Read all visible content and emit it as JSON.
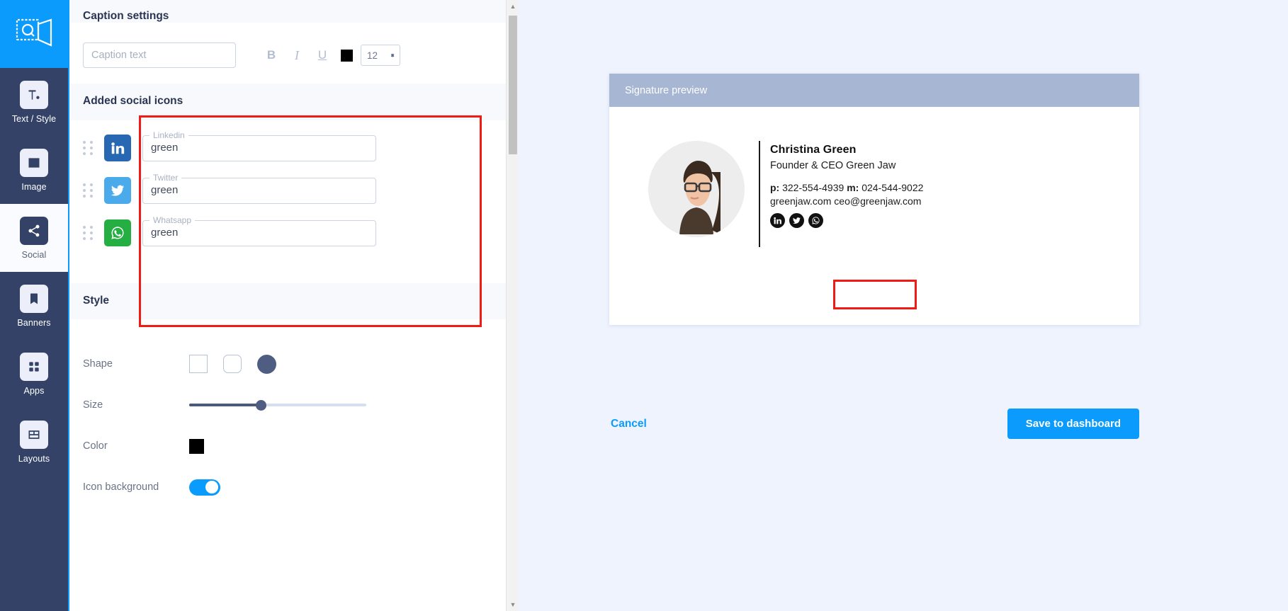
{
  "rail": {
    "logo_icon": "envelope-stamp-logo-icon",
    "items": [
      {
        "label": "Text / Style",
        "icon": "text-style-icon",
        "active": false
      },
      {
        "label": "Image",
        "icon": "image-icon",
        "active": false
      },
      {
        "label": "Social",
        "icon": "share-icon",
        "active": true
      },
      {
        "label": "Banners",
        "icon": "bookmark-icon",
        "active": false
      },
      {
        "label": "Apps",
        "icon": "grid-apps-icon",
        "active": false
      },
      {
        "label": "Layouts",
        "icon": "layouts-icon",
        "active": false
      }
    ]
  },
  "caption": {
    "heading": "Caption settings",
    "input_value": "",
    "input_placeholder": "Caption text",
    "bold_label": "B",
    "italic_label": "I",
    "underline_label": "U",
    "text_color": "#000000",
    "font_size": "12"
  },
  "social": {
    "heading": "Added social icons",
    "rows": [
      {
        "network": "Linkedin",
        "value": "green",
        "brand_color": "#2867b2",
        "icon": "linkedin-icon"
      },
      {
        "network": "Twitter",
        "value": "green",
        "brand_color": "#4aaaea",
        "icon": "twitter-icon"
      },
      {
        "network": "Whatsapp",
        "value": "green",
        "brand_color": "#25ae41",
        "icon": "whatsapp-icon"
      }
    ]
  },
  "style": {
    "heading": "Style",
    "shape_label": "Shape",
    "shape_options": [
      "square",
      "rounded-square",
      "circle"
    ],
    "shape_selected": "circle",
    "size_label": "Size",
    "size_percent": 40,
    "color_label": "Color",
    "color_value": "#000000",
    "icon_background_label": "Icon background",
    "icon_background_on": true
  },
  "preview": {
    "header_title": "Signature preview",
    "signature": {
      "name": "Christina Green",
      "role": "Founder & CEO Green Jaw",
      "phone_label": "p:",
      "phone": "322-554-4939",
      "mobile_label": "m:",
      "mobile": "024-544-9022",
      "website": "greenjaw.com",
      "email": "ceo@greenjaw.com",
      "socials": [
        {
          "network": "Linkedin",
          "icon": "linkedin-icon"
        },
        {
          "network": "Twitter",
          "icon": "twitter-icon"
        },
        {
          "network": "Whatsapp",
          "icon": "whatsapp-icon"
        }
      ]
    }
  },
  "actions": {
    "cancel_label": "Cancel",
    "save_label": "Save to dashboard"
  },
  "colors": {
    "accent": "#0a9bfc",
    "rail_bg": "#334266",
    "highlight": "#ef1b14",
    "preview_header": "#a7b6d2"
  }
}
